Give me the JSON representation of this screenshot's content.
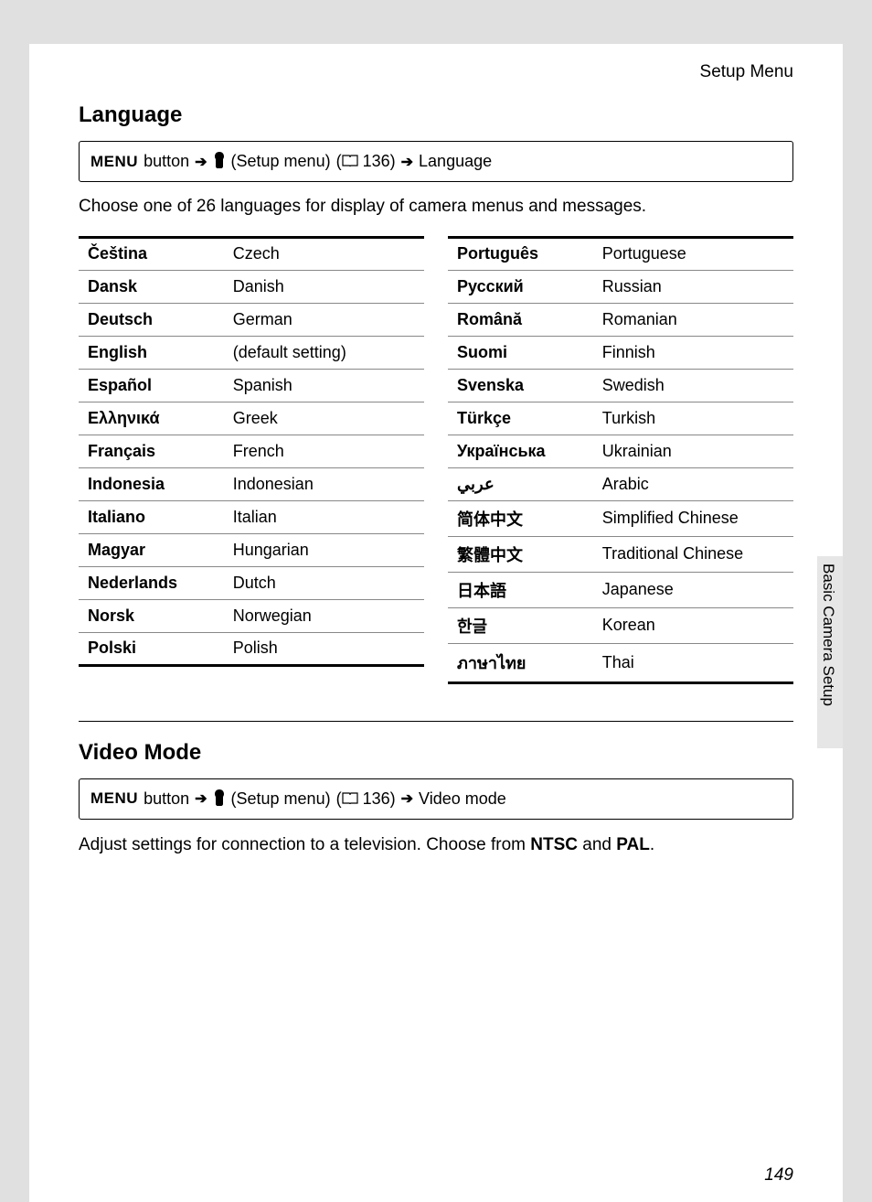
{
  "header": {
    "label": "Setup Menu"
  },
  "sidebar": {
    "label": "Basic Camera Setup"
  },
  "page_number": "149",
  "language_section": {
    "title": "Language",
    "breadcrumb": {
      "menu_label": "MENU",
      "button_word": "button",
      "setup_label": "(Setup menu)",
      "page_ref": "136)",
      "end_label": "Language"
    },
    "intro": "Choose one of 26 languages for display of camera menus and messages.",
    "left": [
      {
        "native": "Čeština",
        "english": "Czech"
      },
      {
        "native": "Dansk",
        "english": "Danish"
      },
      {
        "native": "Deutsch",
        "english": "German"
      },
      {
        "native": "English",
        "english": "(default setting)"
      },
      {
        "native": "Español",
        "english": "Spanish"
      },
      {
        "native": "Ελληνικά",
        "english": "Greek"
      },
      {
        "native": "Français",
        "english": "French"
      },
      {
        "native": "Indonesia",
        "english": "Indonesian"
      },
      {
        "native": "Italiano",
        "english": "Italian"
      },
      {
        "native": "Magyar",
        "english": "Hungarian"
      },
      {
        "native": "Nederlands",
        "english": "Dutch"
      },
      {
        "native": "Norsk",
        "english": "Norwegian"
      },
      {
        "native": "Polski",
        "english": "Polish"
      }
    ],
    "right": [
      {
        "native": "Português",
        "english": "Portuguese"
      },
      {
        "native": "Русский",
        "english": "Russian"
      },
      {
        "native": "Română",
        "english": "Romanian"
      },
      {
        "native": "Suomi",
        "english": "Finnish"
      },
      {
        "native": "Svenska",
        "english": "Swedish"
      },
      {
        "native": "Türkçe",
        "english": "Turkish"
      },
      {
        "native": "Українська",
        "english": "Ukrainian"
      },
      {
        "native": "عربي",
        "english": "Arabic"
      },
      {
        "native": "简体中文",
        "english": "Simplified Chinese"
      },
      {
        "native": "繁體中文",
        "english": "Traditional Chinese"
      },
      {
        "native": "日本語",
        "english": "Japanese"
      },
      {
        "native": "한글",
        "english": "Korean"
      },
      {
        "native": "ภาษาไทย",
        "english": "Thai"
      }
    ]
  },
  "video_section": {
    "title": "Video Mode",
    "breadcrumb": {
      "menu_label": "MENU",
      "button_word": "button",
      "setup_label": "(Setup menu)",
      "page_ref": "136)",
      "end_label": "Video mode"
    },
    "desc_pre": "Adjust settings for connection to a television. Choose from ",
    "opt1": "NTSC",
    "desc_mid": " and ",
    "opt2": "PAL",
    "desc_post": "."
  }
}
